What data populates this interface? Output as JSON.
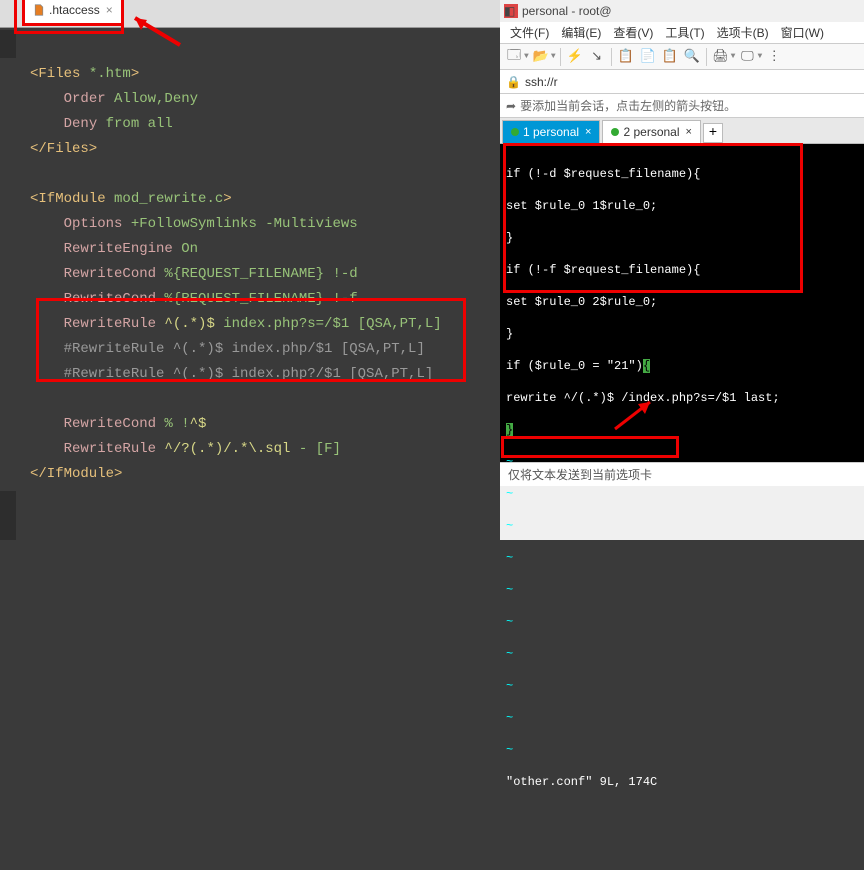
{
  "left": {
    "tab_name": ".htaccess",
    "code": {
      "l1_open": "<Files",
      "l1_arg": " *.htm",
      "l1_close": ">",
      "l2_dir": "Order",
      "l2_val": " Allow,Deny",
      "l3_dir": "Deny",
      "l3_val": " from all",
      "l4_close": "</Files>",
      "l6_open": "<IfModule",
      "l6_arg": " mod_rewrite.c",
      "l6_close": ">",
      "l7_dir": "Options",
      "l7_val": " +FollowSymlinks -Multiviews",
      "l8_dir": "RewriteEngine",
      "l8_val": " On",
      "l9_dir": "RewriteCond",
      "l9_a": " %",
      "l9_b": "{REQUEST_FILENAME}",
      "l9_c": " !-d",
      "l10_dir": "RewriteCond",
      "l10_a": " %",
      "l10_b": "{REQUEST_FILENAME}",
      "l10_c": " !-f",
      "l11_dir": "RewriteRule",
      "l11_a": " ^(.*)$",
      "l11_b": " index.php?s=/$1 [QSA,PT,L]",
      "l12": "    #RewriteRule ^(.*)$ index.php/$1 [QSA,PT,L]",
      "l13": "    #RewriteRule ^(.*)$ index.php?/$1 [QSA,PT,L]",
      "l15_dir": "RewriteCond",
      "l15_a": " % !",
      "l15_b": "^$",
      "l16_dir": "RewriteRule",
      "l16_a": " ^/?",
      "l16_b": "(.*)",
      "l16_c": "/.*\\.sql",
      "l16_d": " - [F]",
      "l17_close": "</IfModule>"
    }
  },
  "right": {
    "window_title": "personal - root@",
    "menu": {
      "file": "文件(F)",
      "edit": "编辑(E)",
      "view": "查看(V)",
      "tool": "工具(T)",
      "tab": "选项卡(B)",
      "win": "窗口(W)"
    },
    "address": "ssh://r",
    "hint": "要添加当前会话，点击左侧的箭头按钮。",
    "tab1": "1 personal",
    "tab2": "2 personal",
    "terminal": {
      "l1": "if (!-d $request_filename){",
      "l2": "set $rule_0 1$rule_0;",
      "l3": "}",
      "l4": "if (!-f $request_filename){",
      "l5": "set $rule_0 2$rule_0;",
      "l6": "}",
      "l7a": "if ($rule_0 = \"21\")",
      "l7b": "{",
      "l8": "rewrite ^/(.*)$ /index.php?s=/$1 last;",
      "l9": "}",
      "status": "\"other.conf\" 9L, 174C"
    },
    "status_bar": "仅将文本发送到当前选项卡"
  },
  "chart_data": null
}
